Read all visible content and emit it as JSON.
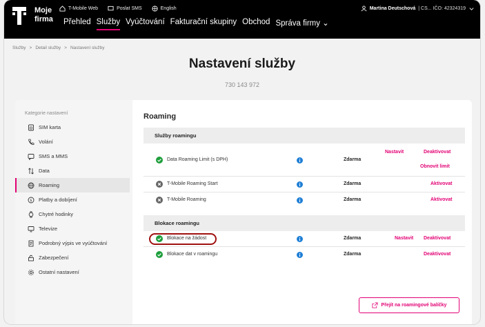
{
  "header": {
    "brand_line1": "Moje",
    "brand_line2": "firma",
    "topnav": [
      "T-Mobile Web",
      "Poslat SMS",
      "English"
    ],
    "mainnav": [
      "Přehled",
      "Služby",
      "Vyúčtování",
      "Fakturační skupiny",
      "Obchod",
      "Správa firmy ⌄"
    ],
    "active_nav": "Služby",
    "user_name": "Martina Deutschová",
    "user_extra": "| CS...  IČO: 42324319"
  },
  "breadcrumb": [
    "Služby",
    ">",
    "Detail služby",
    ">",
    "Nastavení služby"
  ],
  "page_title": "Nastavení služby",
  "phone_number": "730 143 972",
  "sidebar": {
    "category_label": "Kategorie nastavení",
    "items": [
      {
        "label": "SIM karta",
        "icon": "sim-icon"
      },
      {
        "label": "Volání",
        "icon": "phone-icon"
      },
      {
        "label": "SMS a MMS",
        "icon": "message-icon"
      },
      {
        "label": "Data",
        "icon": "data-arrows-icon"
      },
      {
        "label": "Roaming",
        "icon": "globe-icon"
      },
      {
        "label": "Platby a dobíjení",
        "icon": "coin-icon"
      },
      {
        "label": "Chytré hodinky",
        "icon": "watch-icon"
      },
      {
        "label": "Televize",
        "icon": "tv-icon"
      },
      {
        "label": "Podrobný výpis ve vyúčtování",
        "icon": "document-icon"
      },
      {
        "label": "Zabezpečení",
        "icon": "lock-icon"
      },
      {
        "label": "Ostatní nastavení",
        "icon": "gear-icon"
      }
    ],
    "active_item": "Roaming"
  },
  "main": {
    "heading": "Roaming",
    "section1": {
      "title": "Služby roamingu",
      "rows": [
        {
          "name": "Data Roaming Limit (s DPH)",
          "status": "active",
          "price": "Zdarma",
          "actions": [
            "Nastavit",
            "Deaktivovat",
            "Obnovit limit"
          ]
        },
        {
          "name": "T-Mobile Roaming Start",
          "status": "inactive",
          "price": "Zdarma",
          "actions": [
            "Aktivovat"
          ]
        },
        {
          "name": "T-Mobile Roaming",
          "status": "inactive",
          "price": "Zdarma",
          "actions": [
            "Aktivovat"
          ]
        }
      ]
    },
    "section2": {
      "title": "Blokace roamingu",
      "rows": [
        {
          "name": "Blokace na žádost",
          "status": "active",
          "price": "Zdarma",
          "actions": [
            "Nastavit",
            "Deaktivovat"
          ]
        },
        {
          "name": "Blokace dat v roamingu",
          "status": "active",
          "price": "Zdarma",
          "actions": [
            "Deaktivovat"
          ]
        }
      ]
    },
    "packages_button": "Přejít na roamingové balíčky"
  },
  "colors": {
    "accent": "#e20074",
    "active_status": "#1e9e3c",
    "inactive_status": "#666666",
    "info": "#1f7fd6",
    "highlight": "#a01010"
  }
}
